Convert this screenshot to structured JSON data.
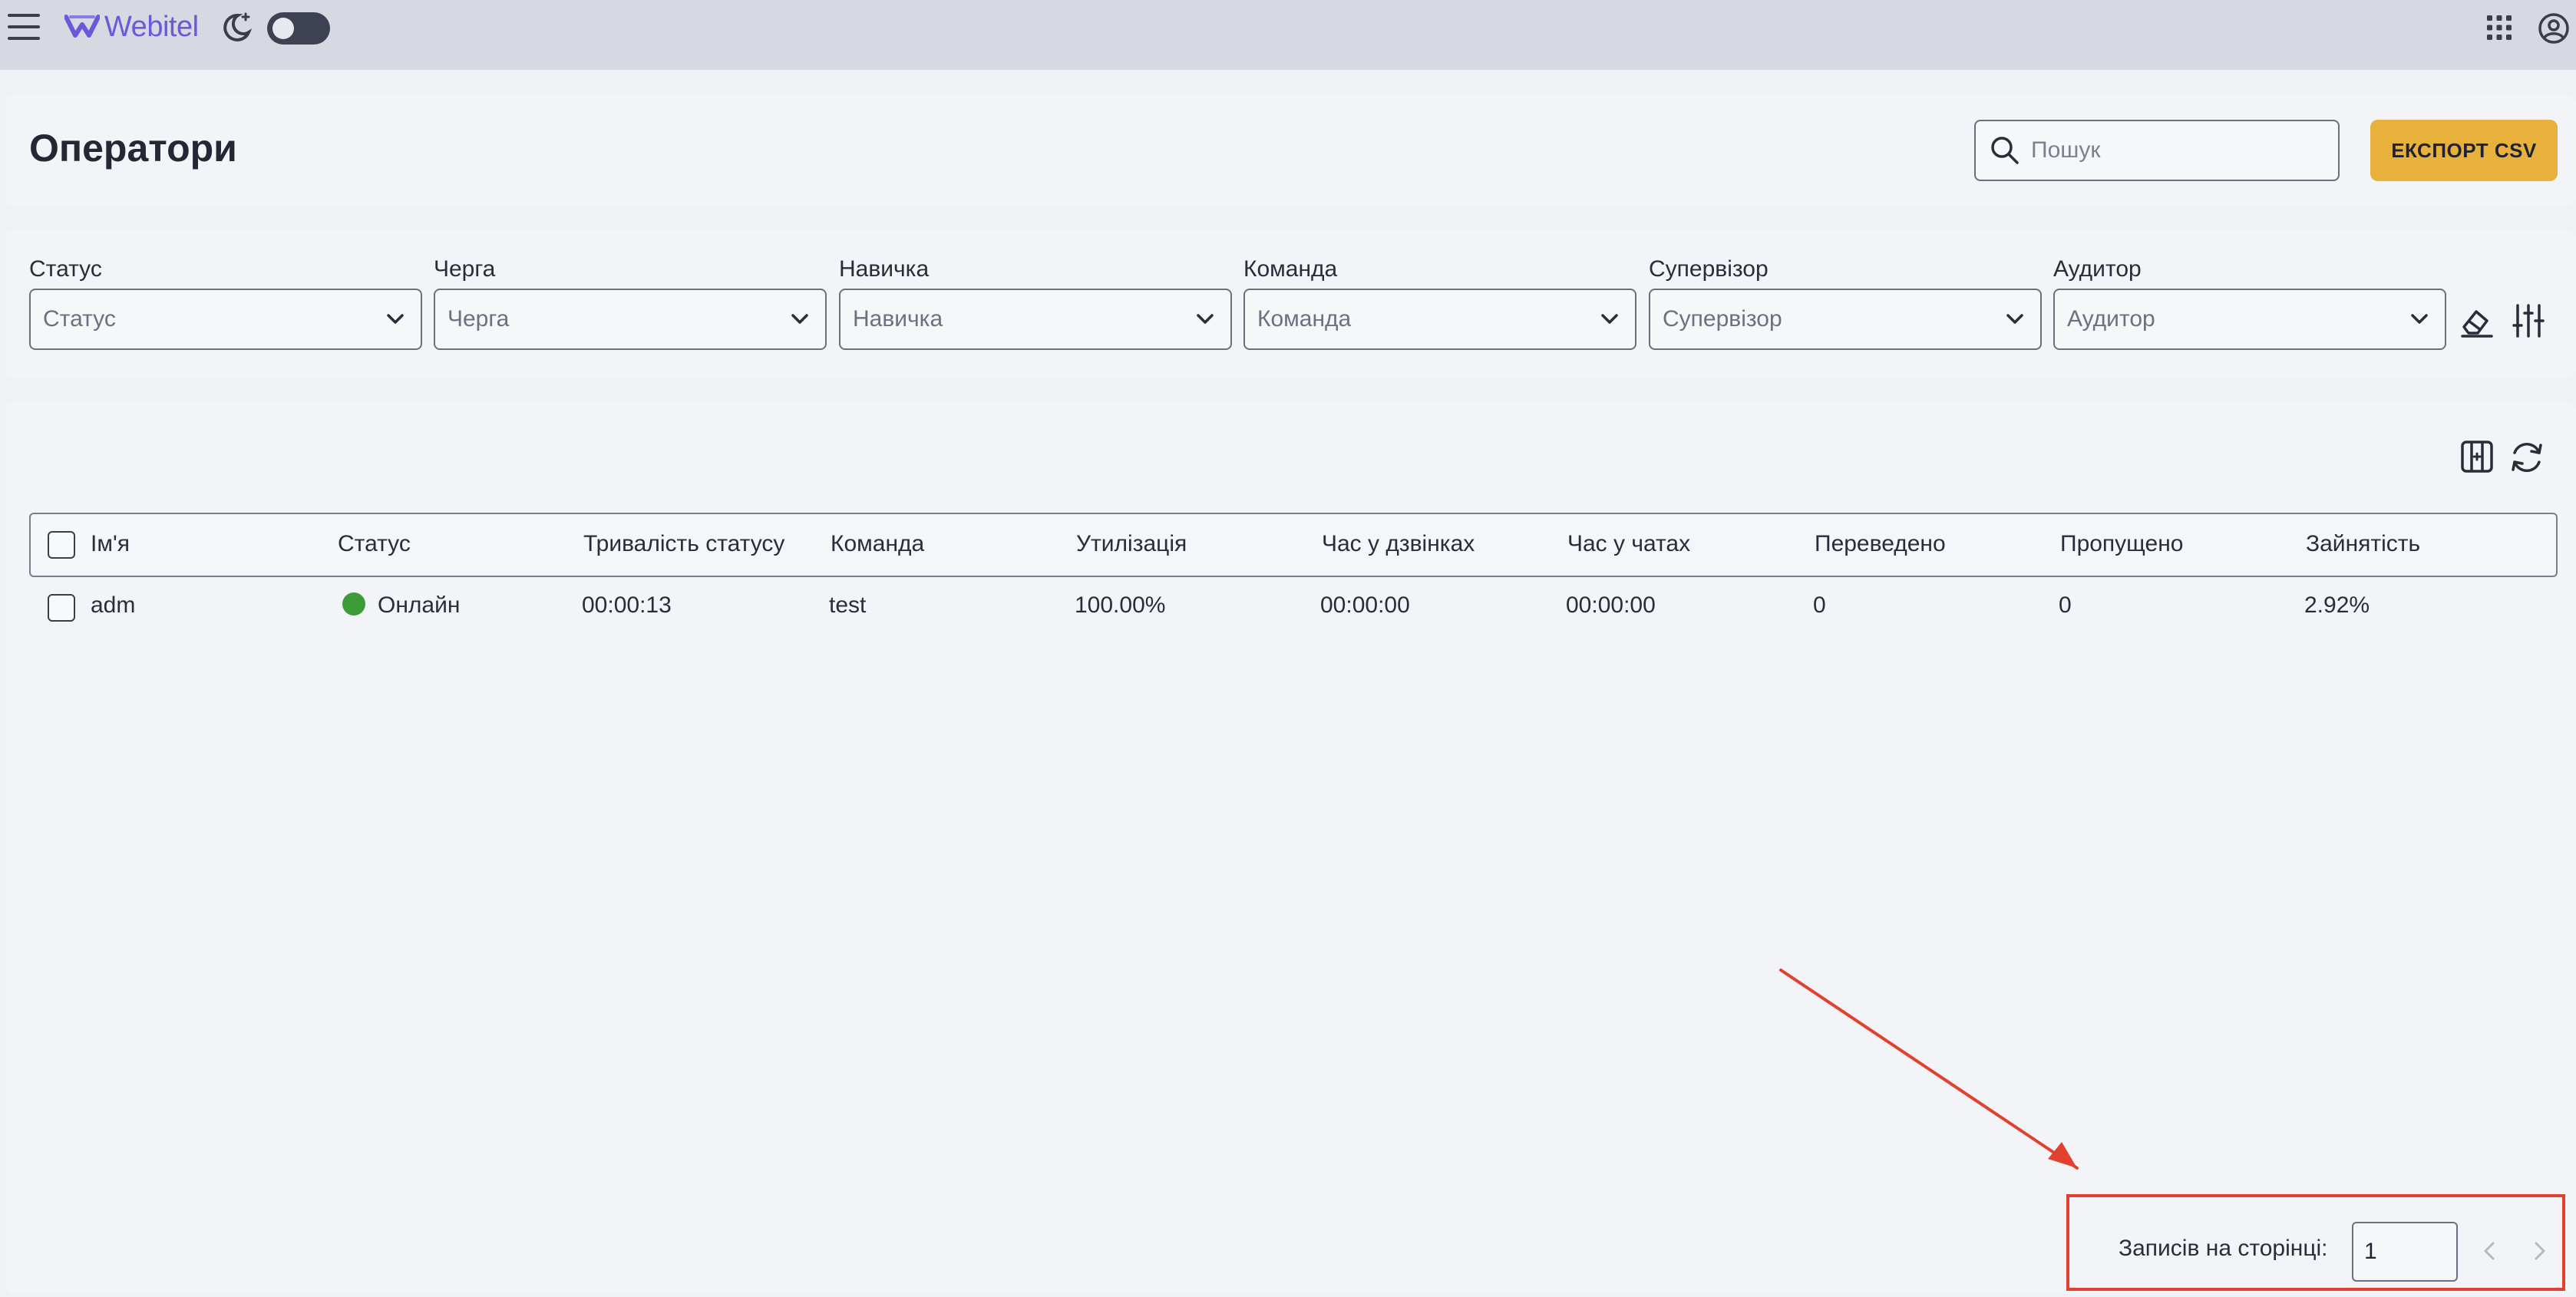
{
  "app": {
    "brand": "Webitel"
  },
  "page": {
    "title": "Оператори"
  },
  "search": {
    "placeholder": "Пошук"
  },
  "export_button": {
    "label": "ЕКСПОРТ CSV"
  },
  "filters": [
    {
      "label": "Статус",
      "placeholder": "Статус"
    },
    {
      "label": "Черга",
      "placeholder": "Черга"
    },
    {
      "label": "Навичка",
      "placeholder": "Навичка"
    },
    {
      "label": "Команда",
      "placeholder": "Команда"
    },
    {
      "label": "Супервізор",
      "placeholder": "Супервізор"
    },
    {
      "label": "Аудитор",
      "placeholder": "Аудитор"
    }
  ],
  "table": {
    "columns": [
      "Ім'я",
      "Статус",
      "Тривалість статусу",
      "Команда",
      "Утилізація",
      "Час у дзвінках",
      "Час у чатах",
      "Переведено",
      "Пропущено",
      "Зайнятість"
    ],
    "rows": [
      {
        "name": "adm",
        "status": "Онлайн",
        "status_duration": "00:00:13",
        "team": "test",
        "utilization": "100.00%",
        "call_time": "00:00:00",
        "chat_time": "00:00:00",
        "transferred": "0",
        "missed": "0",
        "occupancy": "2.92%"
      }
    ]
  },
  "pagination": {
    "per_page_label": "Записів на сторінці:",
    "per_page_value": "1"
  },
  "colors": {
    "accent": "#e8b13b",
    "online": "#3c9c38",
    "annotation": "#e2412f",
    "brand": "#6a59d8"
  },
  "icons": [
    "menu-icon",
    "webitel-logo-icon",
    "theme-moon-icon",
    "apps-grid-icon",
    "account-icon",
    "search-icon",
    "chevron-down-icon",
    "eraser-icon",
    "sliders-icon",
    "columns-icon",
    "refresh-icon",
    "chevron-left-icon",
    "chevron-right-icon"
  ]
}
